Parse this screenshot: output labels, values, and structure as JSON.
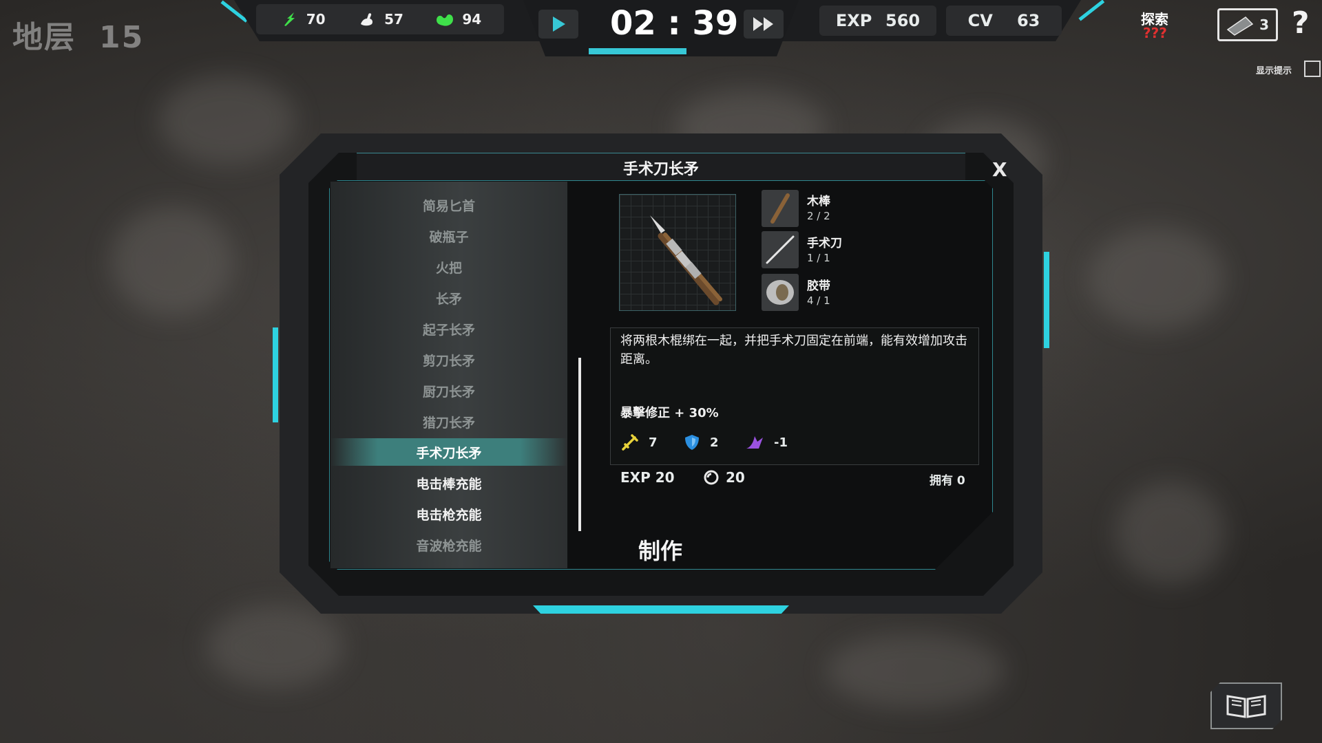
{
  "hud": {
    "floor_label": "地层",
    "floor_value": "15",
    "resources": [
      {
        "icon": "energy-icon",
        "value": "70"
      },
      {
        "icon": "strength-icon",
        "value": "57"
      },
      {
        "icon": "stomach-icon",
        "value": "94"
      }
    ],
    "timer": "02 : 39",
    "exp_label": "EXP",
    "exp_value": "560",
    "cv_label": "CV",
    "cv_value": "63",
    "explore_label": "探索",
    "explore_value": "???",
    "card_count": "3",
    "help": "?",
    "hint_label": "显示提示"
  },
  "dialog": {
    "title": "手术刀长矛",
    "close": "X",
    "recipe_list": [
      {
        "label": "简易匕首",
        "state": "dim"
      },
      {
        "label": "破瓶子",
        "state": "dim"
      },
      {
        "label": "火把",
        "state": "dim"
      },
      {
        "label": "长矛",
        "state": "dim"
      },
      {
        "label": "起子长矛",
        "state": "dim"
      },
      {
        "label": "剪刀长矛",
        "state": "dim"
      },
      {
        "label": "厨刀长矛",
        "state": "dim"
      },
      {
        "label": "猎刀长矛",
        "state": "dim"
      },
      {
        "label": "手术刀长矛",
        "state": "selected"
      },
      {
        "label": "电击棒充能",
        "state": "bright"
      },
      {
        "label": "电击枪充能",
        "state": "bright"
      },
      {
        "label": "音波枪充能",
        "state": "dim"
      }
    ],
    "ingredients": [
      {
        "name": "木棒",
        "count": "2 / 2",
        "icon": "stick-icon"
      },
      {
        "name": "手术刀",
        "count": "1 / 1",
        "icon": "scalpel-icon"
      },
      {
        "name": "胶带",
        "count": "4 / 1",
        "icon": "tape-icon"
      }
    ],
    "description": "将两根木棍绑在一起，并把手术刀固定在前端，能有效增加攻击距离。",
    "crit_mod": "暴擊修正 + 30%",
    "stats": [
      {
        "icon": "attack-icon",
        "value": "7",
        "color": "#e8d23a"
      },
      {
        "icon": "defense-icon",
        "value": "2",
        "color": "#2b8fe0"
      },
      {
        "icon": "speed-icon",
        "value": "-1",
        "color": "#9a52e0"
      }
    ],
    "exp_cost": "EXP  20",
    "material_cost": "20",
    "owned": "拥有    0",
    "craft_label": "制作"
  },
  "colors": {
    "accent": "#2ed2e0",
    "selected": "#3d7f7c",
    "explore_unknown": "#e03030"
  }
}
